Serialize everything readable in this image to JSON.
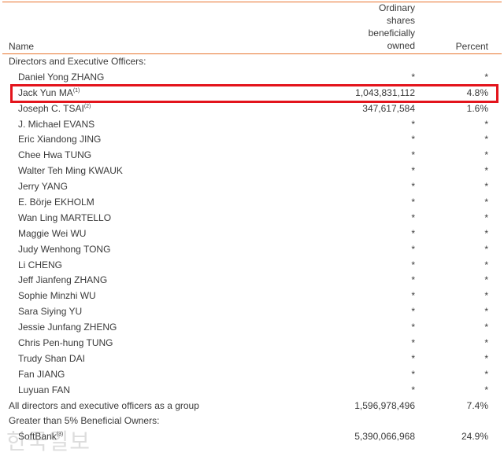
{
  "header": {
    "name": "Name",
    "shares": [
      "Ordinary",
      "shares",
      "beneficially",
      "owned"
    ],
    "percent": "Percent"
  },
  "rows": [
    {
      "type": "group",
      "name": "Directors and Executive Officers:",
      "note": "",
      "shares": "",
      "percent": ""
    },
    {
      "type": "item",
      "name": "Daniel Yong ZHANG",
      "note": "",
      "shares": "*",
      "percent": "*"
    },
    {
      "type": "item",
      "name": "Jack Yun MA",
      "note": "(1)",
      "shares": "1,043,831,112",
      "percent": "4.8%"
    },
    {
      "type": "item",
      "name": "Joseph C. TSAI",
      "note": "(2)",
      "shares": "347,617,584",
      "percent": "1.6%"
    },
    {
      "type": "item",
      "name": "J. Michael EVANS",
      "note": "",
      "shares": "*",
      "percent": "*"
    },
    {
      "type": "item",
      "name": "Eric Xiandong JING",
      "note": "",
      "shares": "*",
      "percent": "*"
    },
    {
      "type": "item",
      "name": "Chee Hwa TUNG",
      "note": "",
      "shares": "*",
      "percent": "*"
    },
    {
      "type": "item",
      "name": "Walter Teh Ming KWAUK",
      "note": "",
      "shares": "*",
      "percent": "*"
    },
    {
      "type": "item",
      "name": "Jerry YANG",
      "note": "",
      "shares": "*",
      "percent": "*"
    },
    {
      "type": "item",
      "name": "E. Börje EKHOLM",
      "note": "",
      "shares": "*",
      "percent": "*"
    },
    {
      "type": "item",
      "name": "Wan Ling MARTELLO",
      "note": "",
      "shares": "*",
      "percent": "*"
    },
    {
      "type": "item",
      "name": "Maggie Wei WU",
      "note": "",
      "shares": "*",
      "percent": "*"
    },
    {
      "type": "item",
      "name": "Judy Wenhong TONG",
      "note": "",
      "shares": "*",
      "percent": "*"
    },
    {
      "type": "item",
      "name": "Li CHENG",
      "note": "",
      "shares": "*",
      "percent": "*"
    },
    {
      "type": "item",
      "name": "Jeff Jianfeng ZHANG",
      "note": "",
      "shares": "*",
      "percent": "*"
    },
    {
      "type": "item",
      "name": "Sophie Minzhi WU",
      "note": "",
      "shares": "*",
      "percent": "*"
    },
    {
      "type": "item",
      "name": "Sara Siying YU",
      "note": "",
      "shares": "*",
      "percent": "*"
    },
    {
      "type": "item",
      "name": "Jessie Junfang ZHENG",
      "note": "",
      "shares": "*",
      "percent": "*"
    },
    {
      "type": "item",
      "name": "Chris Pen-hung TUNG",
      "note": "",
      "shares": "*",
      "percent": "*"
    },
    {
      "type": "item",
      "name": "Trudy Shan DAI",
      "note": "",
      "shares": "*",
      "percent": "*"
    },
    {
      "type": "item",
      "name": "Fan JIANG",
      "note": "",
      "shares": "*",
      "percent": "*"
    },
    {
      "type": "item",
      "name": "Luyuan FAN",
      "note": "",
      "shares": "*",
      "percent": "*"
    },
    {
      "type": "group",
      "name": "All directors and executive officers as a group",
      "note": "",
      "shares": "1,596,978,496",
      "percent": "7.4%"
    },
    {
      "type": "group",
      "name": "Greater than 5% Beneficial Owners:",
      "note": "",
      "shares": "",
      "percent": ""
    },
    {
      "type": "item",
      "name": "SoftBank",
      "note": "(3)",
      "shares": "5,390,066,968",
      "percent": "24.9%"
    }
  ],
  "highlight": {
    "row": "Jack Yun MA",
    "color": "#e3141c"
  },
  "accent_color": "#e8742e",
  "watermark": "한국일보"
}
